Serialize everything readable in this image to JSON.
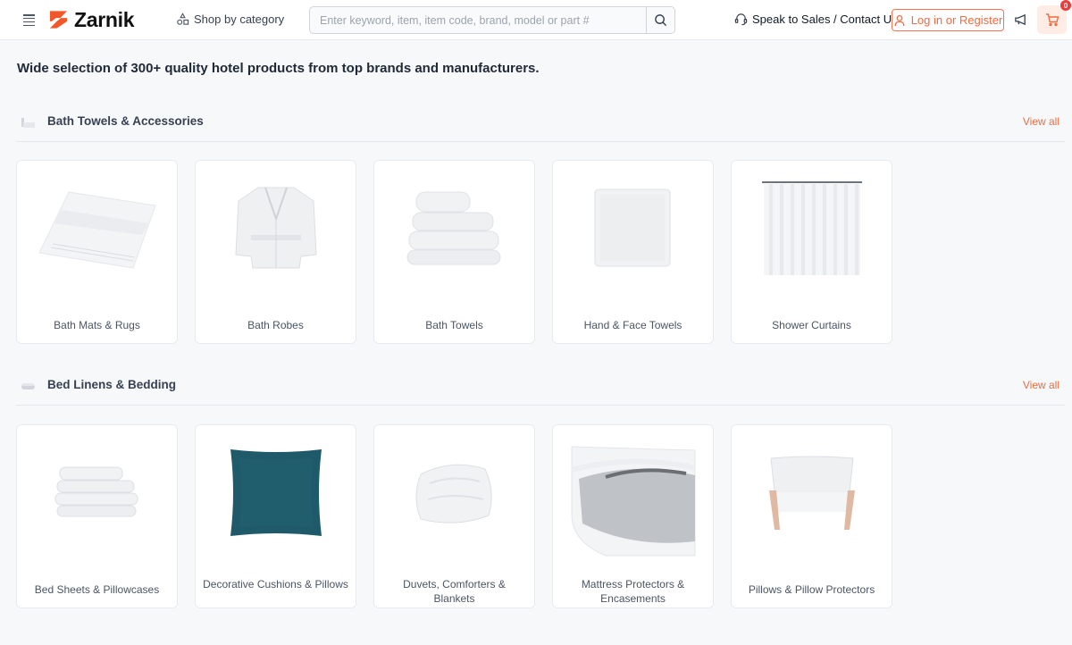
{
  "header": {
    "brand": "Zarnik",
    "shop_by_category": "Shop by category",
    "search_placeholder": "Enter keyword, item, item code, brand, model or part #",
    "search_value": "",
    "speak_to_sales": "Speak to Sales / Contact Us",
    "login": "Log in or Register",
    "cart_count": "0",
    "accent_color": "#f26a3f"
  },
  "intro": "Wide selection of 300+ quality hotel products from top brands and manufacturers.",
  "sections": [
    {
      "title": "Bath Towels & Accessories",
      "view_all": "View all",
      "items": [
        {
          "label": "Bath Mats & Rugs",
          "image": "bath-mat"
        },
        {
          "label": "Bath Robes",
          "image": "bath-robe"
        },
        {
          "label": "Bath Towels",
          "image": "bath-towels"
        },
        {
          "label": "Hand & Face Towels",
          "image": "hand-towel"
        },
        {
          "label": "Shower Curtains",
          "image": "shower-curtain"
        }
      ]
    },
    {
      "title": "Bed Linens & Bedding",
      "view_all": "View all",
      "items": [
        {
          "label": "Bed Sheets & Pillowcases",
          "image": "bed-sheets"
        },
        {
          "label": "Decorative Cushions & Pillows",
          "image": "cushion"
        },
        {
          "label": "Duvets, Comforters & Blankets",
          "image": "duvet"
        },
        {
          "label": "Mattress Protectors & Encasements",
          "image": "mattress-protector"
        },
        {
          "label": "Pillows & Pillow Protectors",
          "image": "pillow"
        }
      ]
    }
  ]
}
